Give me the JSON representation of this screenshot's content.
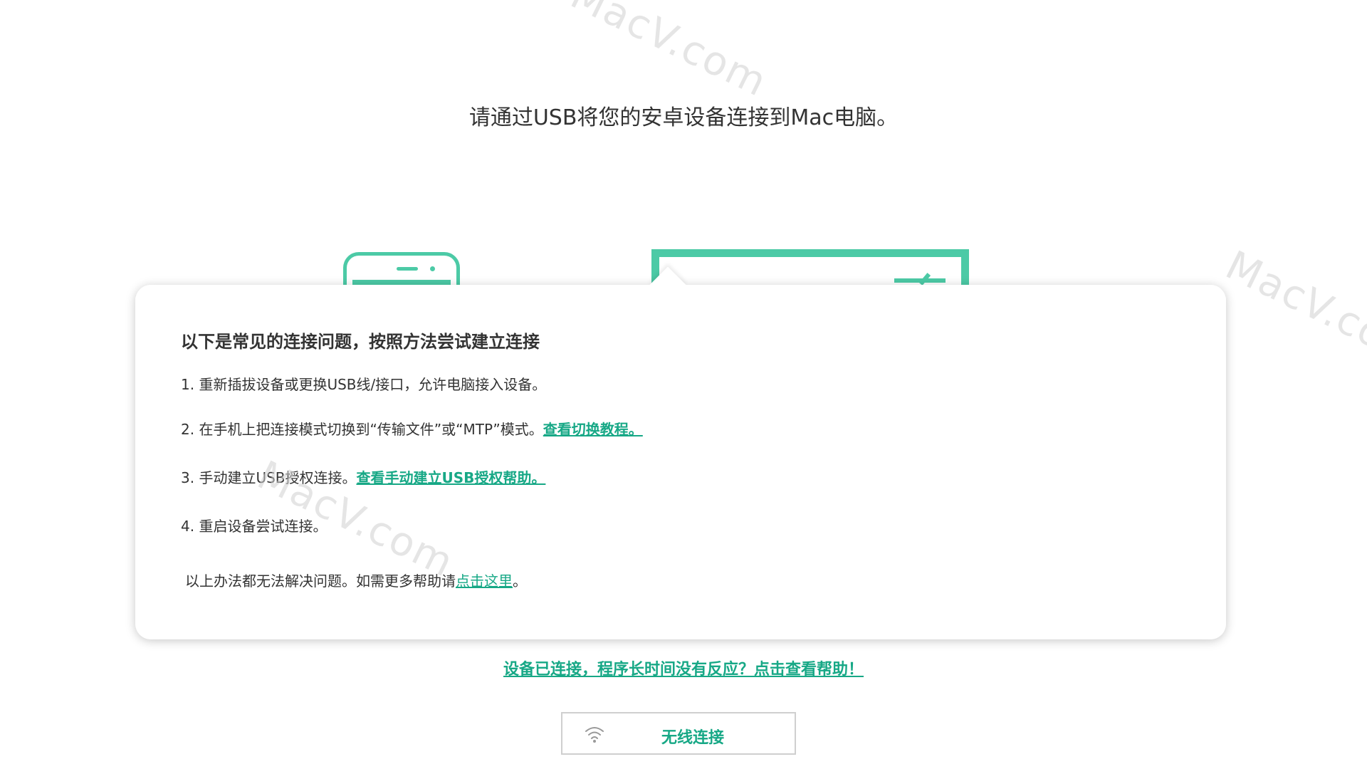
{
  "header": {
    "title": "请通过USB将您的安卓设备连接到Mac电脑。"
  },
  "watermark": "MacV.com",
  "popup": {
    "heading": "以下是常见的连接问题，按照方法尝试建立连接",
    "steps": [
      {
        "text": "1. 重新插拔设备或更换USB线/接口，允许电脑接入设备。",
        "link": ""
      },
      {
        "text": "2. 在手机上把连接模式切换到“传输文件”或“MTP”模式。",
        "link": "查看切换教程。"
      },
      {
        "text": "3. 手动建立USB授权连接。",
        "link": "查看手动建立USB授权帮助。"
      },
      {
        "text": "4. 重启设备尝试连接。",
        "link": ""
      }
    ],
    "footer_prefix": "以上办法都无法解决问题。如需更多帮助请",
    "footer_link": "点击这里",
    "footer_suffix": "。"
  },
  "help_link": "设备已连接，程序长时间没有反应？点击查看帮助！",
  "wireless_button": {
    "label": "无线连接",
    "icon": "wifi-icon"
  },
  "colors": {
    "accent": "#17a886",
    "illustration": "#4ccaa6"
  }
}
